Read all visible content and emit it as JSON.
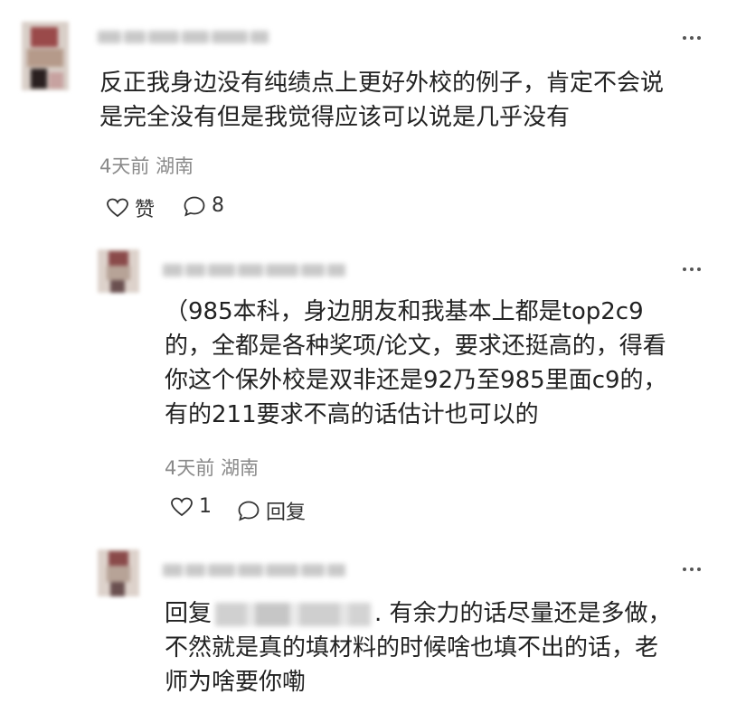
{
  "comments": [
    {
      "text": "反正我身边没有纯绩点上更好外校的例子，肯定不会说是完全没有但是我觉得应该可以说是几乎没有",
      "line1": "反正我身边没有纯绩点上更好外校的例子，肯定不会说",
      "line2": "是完全没有但是我觉得应该可以说是几乎没有",
      "time": "4天前",
      "location": "湖南",
      "like_label": "赞",
      "reply_count": "8"
    }
  ],
  "replies": [
    {
      "line1": "（985本科，身边朋友和我基本上都是top2c9",
      "line2": "的，全都是各种奖项/论文，要求还挺高的，得看",
      "line3": "你这个保外校是双非还是92乃至985里面c9的，",
      "line4": "有的211要求不高的话估计也可以的",
      "time": "4天前",
      "location": "湖南",
      "like_count": "1",
      "reply_label": "回复"
    },
    {
      "reply_prefix": "回复",
      "line1_tail": ". 有余力的话尽量还是多做，",
      "line2": "不然就是真的填材料的时候啥也填不出的话，老",
      "line3": "师为啥要你嘞"
    }
  ],
  "icons": {
    "more": "more-horizontal-icon",
    "like": "heart-outline-icon",
    "comment": "comment-bubble-icon"
  }
}
